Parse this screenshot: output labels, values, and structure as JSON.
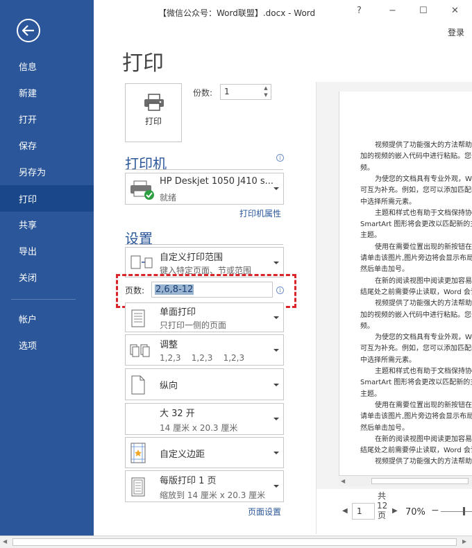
{
  "window": {
    "title": "【微信公众号：Word联盟】.docx - Word",
    "help": "?",
    "minimize": "−",
    "maximize": "☐",
    "close": "✕",
    "login": "登录"
  },
  "sidebar": {
    "items": [
      {
        "label": "信息"
      },
      {
        "label": "新建"
      },
      {
        "label": "打开"
      },
      {
        "label": "保存"
      },
      {
        "label": "另存为"
      },
      {
        "label": "打印",
        "active": true
      },
      {
        "label": "共享"
      },
      {
        "label": "导出"
      },
      {
        "label": "关闭"
      },
      {
        "label": "帐户"
      },
      {
        "label": "选项"
      }
    ]
  },
  "print": {
    "title": "打印",
    "button_label": "打印",
    "copies_label": "份数:",
    "copies_value": "1"
  },
  "printer": {
    "section_title": "打印机",
    "name": "HP Deskjet 1050 J410 s...",
    "status": "就绪",
    "properties_link": "打印机属性"
  },
  "settings": {
    "section_title": "设置",
    "range_main": "自定义打印范围",
    "range_sub": "键入特定页面、节或范围",
    "pages_label": "页数:",
    "pages_value": "2,6,8-12",
    "sides_main": "单面打印",
    "sides_sub": "只打印一侧的页面",
    "collate_main": "调整",
    "collate_sub": "1,2,3    1,2,3    1,2,3",
    "orientation_main": "纵向",
    "paper_main": "大 32 开",
    "paper_sub": "14 厘米 x 20.3 厘米",
    "margins_main": "自定义边距",
    "perpage_main": "每版打印 1 页",
    "perpage_sub": "缩放到 14 厘米 x 20.3 厘米",
    "page_setup_link": "页面设置"
  },
  "preview": {
    "lines": [
      "视频提供了功能强大的方法帮助您",
      "加的视频的嵌入代码中进行粘贴。您也",
      "频。",
      "为使您的文档具有专业外观，Wo",
      "可互为补充。例如，您可以添加匹配的",
      "中选择所需元素。",
      "主题和样式也有助于文档保持协调",
      "SmartArt 图形将会更改以匹配新的主",
      "主题。",
      "使用在需要位置出现的新按钮在",
      "请单击该图片,图片旁边将会显示布局",
      "然后单击加号。",
      "在新的阅读视图中阅读更加容易。",
      "结尾处之前需要停止读取，Word 会记",
      "视频提供了功能强大的方法帮助您",
      "加的视频的嵌入代码中进行粘贴。您也",
      "频。",
      "为使您的文档具有专业外观，Wo",
      "可互为补充。例如，您可以添加匹配的",
      "中选择所需元素。",
      "主题和样式也有助于文档保持协调",
      "SmartArt 图形将会更改以匹配新的主",
      "主题。",
      "使用在需要位置出现的新按钮在",
      "请单击该图片,图片旁边将会显示布局",
      "然后单击加号。",
      "在新的阅读视图中阅读更加容易。",
      "结尾处之前需要停止读取，Word 会记",
      "视频提供了功能强大的方法帮助您"
    ],
    "page_value": "1",
    "total_prefix": "共",
    "total_count": "12",
    "total_suffix": "页",
    "zoom": "70%",
    "zoom_minus": "−"
  }
}
